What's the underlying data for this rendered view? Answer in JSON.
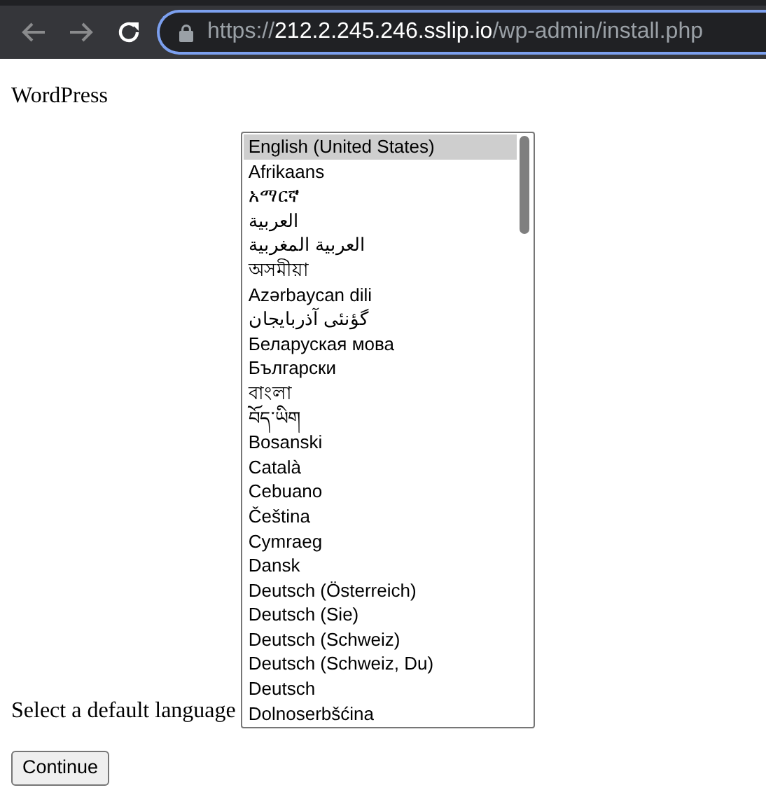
{
  "browser": {
    "url_scheme": "https://",
    "url_host": "212.2.245.246.sslip.io",
    "url_path": "/wp-admin/install.php"
  },
  "page": {
    "heading": "WordPress",
    "label": "Select a default language",
    "button": "Continue"
  },
  "languages": [
    {
      "label": "English (United States)",
      "selected": true
    },
    {
      "label": "Afrikaans",
      "selected": false
    },
    {
      "label": "አማርኛ",
      "selected": false
    },
    {
      "label": "العربية",
      "selected": false
    },
    {
      "label": "العربية المغربية",
      "selected": false
    },
    {
      "label": "অসমীয়া",
      "selected": false
    },
    {
      "label": "Azərbaycan dili",
      "selected": false
    },
    {
      "label": "گؤنئی آذربایجان",
      "selected": false
    },
    {
      "label": "Беларуская мова",
      "selected": false
    },
    {
      "label": "Български",
      "selected": false
    },
    {
      "label": "বাংলা",
      "selected": false
    },
    {
      "label": "བོད་ཡིག",
      "selected": false
    },
    {
      "label": "Bosanski",
      "selected": false
    },
    {
      "label": "Català",
      "selected": false
    },
    {
      "label": "Cebuano",
      "selected": false
    },
    {
      "label": "Čeština",
      "selected": false
    },
    {
      "label": "Cymraeg",
      "selected": false
    },
    {
      "label": "Dansk",
      "selected": false
    },
    {
      "label": "Deutsch (Österreich)",
      "selected": false
    },
    {
      "label": "Deutsch (Sie)",
      "selected": false
    },
    {
      "label": "Deutsch (Schweiz)",
      "selected": false
    },
    {
      "label": "Deutsch (Schweiz, Du)",
      "selected": false
    },
    {
      "label": "Deutsch",
      "selected": false
    },
    {
      "label": "Dolnoserbšćina",
      "selected": false
    }
  ]
}
